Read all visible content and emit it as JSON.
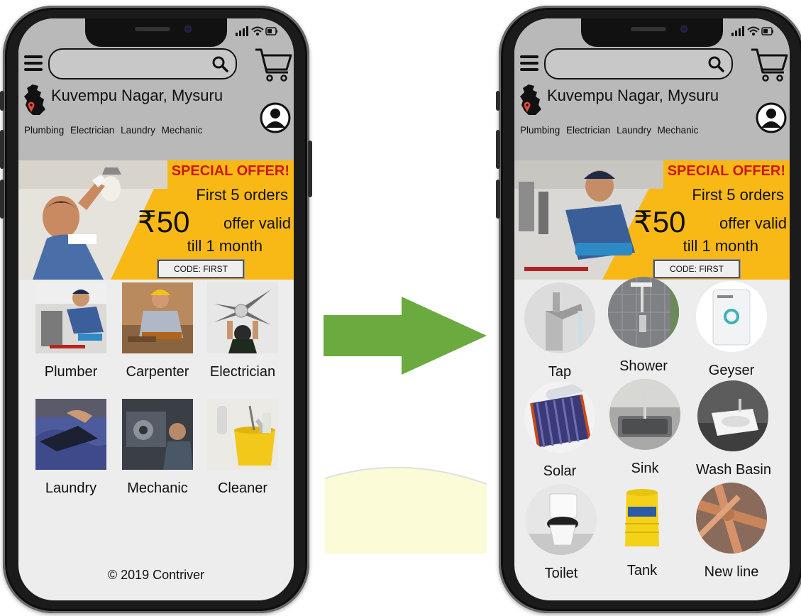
{
  "colors": {
    "screen_bg": "#ededed",
    "header_bg": "#b9b9b9",
    "banner_yellow": "#f8b916",
    "offer_red": "#cc1818",
    "arrow_green": "#6aaa3f"
  },
  "left_phone": {
    "header": {
      "location": "Kuvempu Nagar, Mysuru",
      "categories": [
        "Plumbing",
        "Electrician",
        "Laundry",
        "Mechanic"
      ]
    },
    "banner": {
      "title": "SPECIAL OFFER!",
      "line1": "First 5 orders",
      "amount": "₹50",
      "line2": "offer valid",
      "line3": "till 1 month",
      "code": "CODE: FIRST"
    },
    "tiles": [
      {
        "label": "Plumber",
        "icon": "plumber-photo"
      },
      {
        "label": "Carpenter",
        "icon": "carpenter-photo"
      },
      {
        "label": "Electrician",
        "icon": "electrician-photo"
      },
      {
        "label": "Laundry",
        "icon": "laundry-photo"
      },
      {
        "label": "Mechanic",
        "icon": "mechanic-photo"
      },
      {
        "label": "Cleaner",
        "icon": "cleaner-photo"
      }
    ],
    "footer": "© 2019 Contriver"
  },
  "right_phone": {
    "header": {
      "location": "Kuvempu Nagar, Mysuru",
      "categories": [
        "Plumbing",
        "Electrician",
        "Laundry",
        "Mechanic"
      ]
    },
    "banner": {
      "title": "SPECIAL OFFER!",
      "line1": "First 5 orders",
      "amount": "₹50",
      "line2": "offer valid",
      "line3": "till 1 month",
      "code": "CODE: FIRST"
    },
    "tiles": [
      {
        "label": "Tap",
        "icon": "tap-photo"
      },
      {
        "label": "Shower",
        "icon": "shower-photo"
      },
      {
        "label": "Geyser",
        "icon": "geyser-photo"
      },
      {
        "label": "Solar",
        "icon": "solar-photo"
      },
      {
        "label": "Sink",
        "icon": "sink-photo"
      },
      {
        "label": "Wash Basin",
        "icon": "wash-basin-photo"
      },
      {
        "label": "Toilet",
        "icon": "toilet-photo"
      },
      {
        "label": "Tank",
        "icon": "tank-photo"
      },
      {
        "label": "New line",
        "icon": "new-line-photo"
      }
    ]
  }
}
